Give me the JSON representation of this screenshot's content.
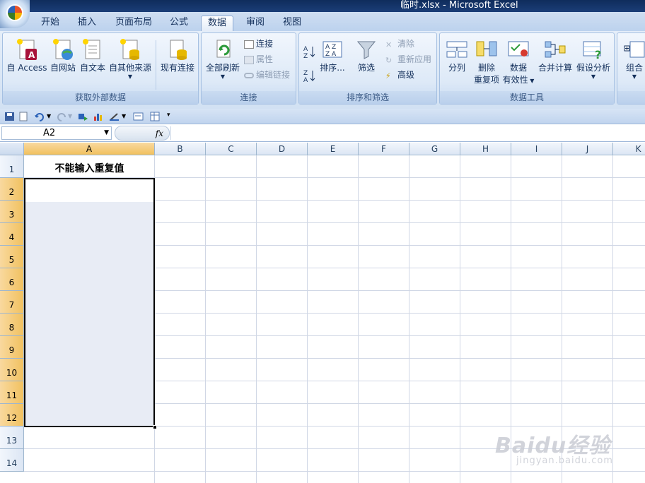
{
  "window": {
    "title": "临时.xlsx - Microsoft Excel"
  },
  "tabs": [
    "开始",
    "插入",
    "页面布局",
    "公式",
    "数据",
    "审阅",
    "视图"
  ],
  "active_tab": "数据",
  "ribbon": {
    "groups": [
      {
        "label": "获取外部数据",
        "buttons": [
          "自 Access",
          "自网站",
          "自文本",
          "自其他来源",
          "现有连接"
        ]
      },
      {
        "label": "连接",
        "buttons": [
          "全部刷新",
          "连接",
          "属性",
          "编辑链接"
        ]
      },
      {
        "label": "排序和筛选",
        "buttons": [
          "排序...",
          "筛选",
          "清除",
          "重新应用",
          "高级"
        ]
      },
      {
        "label": "数据工具",
        "buttons": [
          "分列",
          "删除",
          "重复项",
          "数据",
          "有效性",
          "合并计算",
          "假设分析"
        ]
      },
      {
        "label": "",
        "buttons": [
          "组合"
        ]
      }
    ]
  },
  "formula_bar": {
    "name_box": "A2",
    "fx_label": "fx",
    "formula": ""
  },
  "columns": [
    "A",
    "B",
    "C",
    "D",
    "E",
    "F",
    "G",
    "H",
    "I",
    "J",
    "K"
  ],
  "rows": [
    "1",
    "2",
    "3",
    "4",
    "5",
    "6",
    "7",
    "8",
    "9",
    "10",
    "11",
    "12",
    "13",
    "14"
  ],
  "cells": {
    "A1": "不能输入重复值"
  },
  "watermark": {
    "brand": "Baidu经验",
    "url": "jingyan.baidu.com"
  },
  "colors": {
    "selection_border": "#000000",
    "header_selected": "#f1c15f",
    "grid": "#d0d7e5",
    "selected_fill": "#e8ecf5"
  }
}
